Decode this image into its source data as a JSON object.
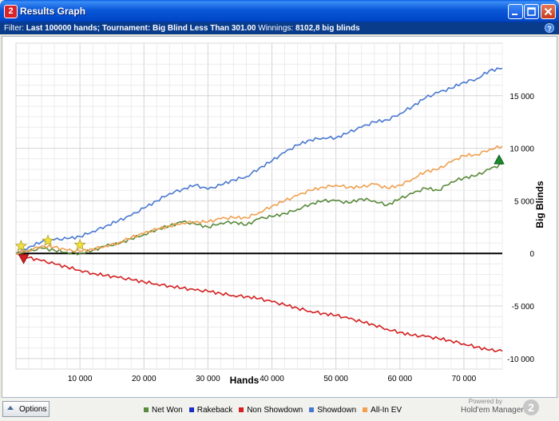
{
  "window": {
    "title": "Results Graph",
    "app_icon_text": "2"
  },
  "filter": {
    "label": "Filter:",
    "hands": "Last 100000 hands;",
    "tournament": "Tournament: Big Blind Less Than 301.00",
    "winnings_label": "Winnings:",
    "winnings_value": "8102,8 big blinds",
    "help_text": "?"
  },
  "bottom": {
    "options_label": "Options",
    "powered_by": "Powered by",
    "brand": "Hold'em Manager",
    "brand_badge": "2"
  },
  "legend": [
    {
      "name": "Net Won",
      "color": "#5a8a3c"
    },
    {
      "name": "Rakeback",
      "color": "#1a2ec8"
    },
    {
      "name": "Non Showdown",
      "color": "#d42020"
    },
    {
      "name": "Showdown",
      "color": "#4a78d0"
    },
    {
      "name": "All-In EV",
      "color": "#f0a050"
    }
  ],
  "chart_data": {
    "type": "line",
    "xlabel": "Hands",
    "ylabel": "Big Blinds",
    "xlim": [
      0,
      76000
    ],
    "ylim": [
      -11000,
      20000
    ],
    "x_ticks": [
      10000,
      20000,
      30000,
      40000,
      50000,
      60000,
      70000
    ],
    "x_tick_labels": [
      "10 000",
      "20 000",
      "30 000",
      "40 000",
      "50 000",
      "60 000",
      "70 000"
    ],
    "y_ticks": [
      -10000,
      -5000,
      0,
      5000,
      10000,
      15000
    ],
    "y_tick_labels": [
      "-10 000",
      "-5 000",
      "0",
      "5 000",
      "10 000",
      "15 000"
    ],
    "y_axis_position": "right",
    "grid": true,
    "legend_position": "bottom",
    "series": [
      {
        "name": "Net Won",
        "color": "#5a8a3c",
        "x": [
          0,
          2000,
          4000,
          6000,
          8000,
          10000,
          12000,
          14000,
          16000,
          18000,
          20000,
          22000,
          24000,
          26000,
          28000,
          30000,
          32000,
          34000,
          36000,
          38000,
          40000,
          42000,
          44000,
          46000,
          48000,
          50000,
          52000,
          54000,
          56000,
          58000,
          60000,
          62000,
          64000,
          66000,
          68000,
          70000,
          72000,
          74000,
          76000
        ],
        "y": [
          0,
          200,
          500,
          300,
          100,
          0,
          300,
          700,
          900,
          1400,
          1800,
          2300,
          2600,
          3000,
          2800,
          2500,
          2900,
          3000,
          2700,
          3300,
          3500,
          3800,
          4200,
          4700,
          5000,
          5000,
          4800,
          5200,
          5000,
          4600,
          5200,
          5700,
          6200,
          6000,
          6800,
          7200,
          7400,
          8000,
          8500
        ]
      },
      {
        "name": "Non Showdown",
        "color": "#d42020",
        "x": [
          0,
          2000,
          4000,
          6000,
          8000,
          10000,
          12000,
          14000,
          16000,
          18000,
          20000,
          22000,
          24000,
          26000,
          28000,
          30000,
          32000,
          34000,
          36000,
          38000,
          40000,
          42000,
          44000,
          46000,
          48000,
          50000,
          52000,
          54000,
          56000,
          58000,
          60000,
          62000,
          64000,
          66000,
          68000,
          70000,
          72000,
          74000,
          76000
        ],
        "y": [
          0,
          -400,
          -700,
          -1000,
          -1300,
          -1600,
          -1900,
          -2100,
          -2300,
          -2500,
          -2700,
          -2900,
          -3100,
          -3300,
          -3500,
          -3600,
          -3800,
          -4000,
          -4100,
          -4300,
          -4600,
          -4900,
          -5200,
          -5500,
          -5700,
          -5900,
          -6200,
          -6500,
          -6800,
          -7200,
          -7500,
          -7800,
          -7900,
          -8100,
          -8300,
          -8600,
          -8900,
          -9200,
          -9300
        ]
      },
      {
        "name": "Showdown",
        "color": "#4a78d0",
        "x": [
          0,
          2000,
          4000,
          6000,
          8000,
          10000,
          12000,
          14000,
          16000,
          18000,
          20000,
          22000,
          24000,
          26000,
          28000,
          30000,
          32000,
          34000,
          36000,
          38000,
          40000,
          42000,
          44000,
          46000,
          48000,
          50000,
          52000,
          54000,
          56000,
          58000,
          60000,
          62000,
          64000,
          66000,
          68000,
          70000,
          72000,
          74000,
          76000
        ],
        "y": [
          0,
          600,
          1100,
          1300,
          1400,
          1600,
          2100,
          2600,
          3100,
          3600,
          4300,
          5000,
          5700,
          6100,
          6500,
          6100,
          6500,
          7000,
          7300,
          8100,
          8800,
          9600,
          10300,
          10800,
          11000,
          11000,
          11500,
          12000,
          12500,
          12700,
          13300,
          14000,
          14800,
          15300,
          15700,
          16300,
          16600,
          17400,
          17600
        ]
      },
      {
        "name": "All-In EV",
        "color": "#f0a050",
        "x": [
          0,
          2000,
          4000,
          6000,
          8000,
          10000,
          12000,
          14000,
          16000,
          18000,
          20000,
          22000,
          24000,
          26000,
          28000,
          30000,
          32000,
          34000,
          36000,
          38000,
          40000,
          42000,
          44000,
          46000,
          48000,
          50000,
          52000,
          54000,
          56000,
          58000,
          60000,
          62000,
          64000,
          66000,
          68000,
          70000,
          72000,
          74000,
          76000
        ],
        "y": [
          0,
          300,
          700,
          600,
          300,
          200,
          400,
          700,
          1000,
          1500,
          1900,
          2300,
          2600,
          2900,
          3000,
          3000,
          3300,
          3400,
          3400,
          3900,
          4500,
          5000,
          5500,
          6000,
          6300,
          6500,
          6300,
          6300,
          6600,
          6200,
          6500,
          7100,
          7800,
          8000,
          8700,
          9300,
          9400,
          9900,
          10200
        ]
      }
    ],
    "markers": [
      {
        "type": "star",
        "x": 800,
        "y": 700,
        "color": "#f0e040"
      },
      {
        "type": "star",
        "x": 5000,
        "y": 1200,
        "color": "#f0e040"
      },
      {
        "type": "star",
        "x": 10000,
        "y": 800,
        "color": "#f0e040"
      },
      {
        "type": "triangle-down",
        "x": 1200,
        "y": -500,
        "color": "#d42020"
      },
      {
        "type": "triangle-up",
        "x": 75500,
        "y": 8900,
        "color": "#1a8a2a"
      }
    ]
  }
}
